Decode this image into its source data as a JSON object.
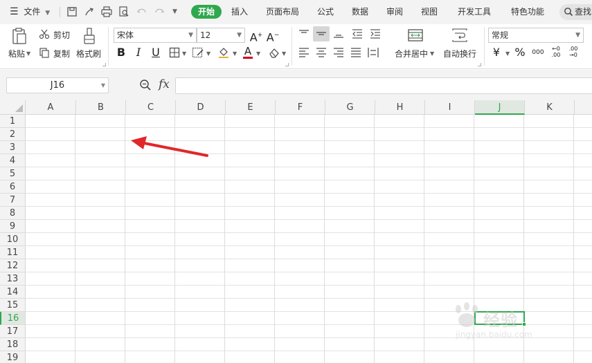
{
  "menubar": {
    "file_label": "文件",
    "tabs": [
      {
        "label": "开始",
        "active": true
      },
      {
        "label": "插入"
      },
      {
        "label": "页面布局"
      },
      {
        "label": "公式"
      },
      {
        "label": "数据"
      },
      {
        "label": "审阅"
      },
      {
        "label": "视图"
      },
      {
        "label": "开发工具"
      },
      {
        "label": "特色功能"
      }
    ],
    "search_label": "查找"
  },
  "ribbon": {
    "paste_label": "粘贴",
    "cut_label": "剪切",
    "copy_label": "复制",
    "format_painter_label": "格式刷",
    "font_name": "宋体",
    "font_size": "12",
    "bold": "B",
    "italic": "I",
    "underline": "U",
    "merge_center_label": "合并居中",
    "wrap_text_label": "自动换行",
    "number_format": "常规",
    "currency_symbol": "¥",
    "percent_symbol": "%",
    "thousands_symbol": "000",
    "inc_decimal": "←0\n.00",
    "dec_decimal": ".00\n→0"
  },
  "formula_bar": {
    "name_box": "J16",
    "fx_label": "fx",
    "formula_value": ""
  },
  "sheet": {
    "columns": [
      "A",
      "B",
      "C",
      "D",
      "E",
      "F",
      "G",
      "H",
      "I",
      "J",
      "K"
    ],
    "rows": [
      "1",
      "2",
      "3",
      "4",
      "5",
      "6",
      "7",
      "8",
      "9",
      "10",
      "11",
      "12",
      "13",
      "14",
      "15",
      "16",
      "17",
      "18",
      "19"
    ],
    "selected_column": "J",
    "selected_row": "16",
    "active_cell": "J16"
  },
  "watermark": {
    "text": "经验",
    "sub": "jingyan.baidu.com"
  },
  "colors": {
    "accent_green": "#2fa84f",
    "annotation_red": "#e0282b"
  }
}
